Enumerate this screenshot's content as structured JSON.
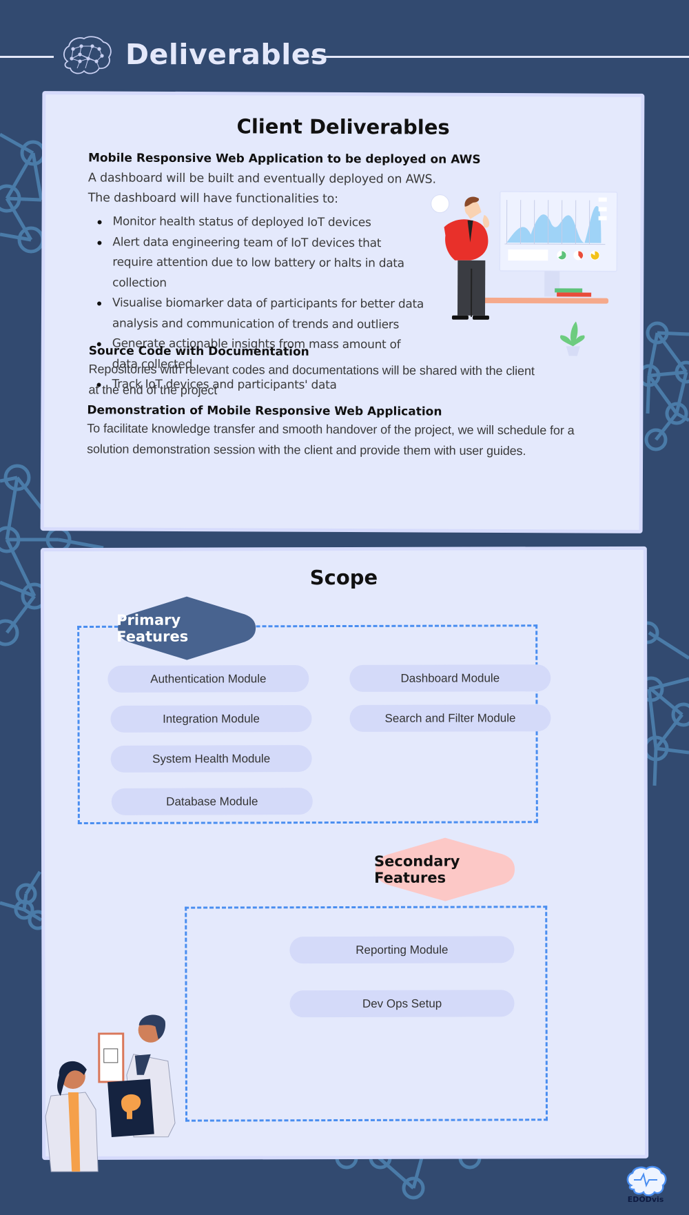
{
  "header": {
    "title": "Deliverables"
  },
  "client_deliverables": {
    "title": "Client Deliverables",
    "sections": [
      {
        "heading": "Mobile Responsive Web Application to be deployed on AWS",
        "text_lines": [
          "A dashboard will be built and eventually deployed on AWS.",
          "The dashboard will have functionalities to:"
        ],
        "bullets": [
          "Monitor health status of deployed IoT devices",
          "Alert data engineering team of IoT devices that require attention due to low battery or halts in data collection",
          "Visualise biomarker data of participants for better data analysis and communication of trends and outliers",
          "Generate actionable insights from mass amount of data collected",
          "Track IoT devices and participants' data"
        ]
      },
      {
        "heading": "Source Code with Documentation",
        "text": "Repositories with relevant codes and documentations will be shared with the client at the end of the project"
      },
      {
        "heading": "Demonstration of Mobile Responsive Web Application",
        "text": "To facilitate knowledge transfer and smooth handover of the project, we will schedule for a solution demonstration session with the client and provide them with user guides."
      }
    ]
  },
  "scope": {
    "title": "Scope",
    "primary": {
      "label": "Primary Features",
      "modules": [
        "Authentication Module",
        "Dashboard Module",
        "Integration Module",
        "Search and Filter Module",
        "System Health Module",
        "Database Module"
      ]
    },
    "secondary": {
      "label": "Secondary Features",
      "modules": [
        "Reporting Module",
        "Dev Ops Setup"
      ]
    }
  },
  "logo": {
    "text": "EDODvis"
  },
  "colors": {
    "background": "#324a70",
    "card": "#e4e9fc",
    "pill": "#d4daf9",
    "dash": "#4a8ef0",
    "primary_badge": "#48638f",
    "secondary_badge": "#fcc8c6",
    "network": "#4a7ba8"
  }
}
